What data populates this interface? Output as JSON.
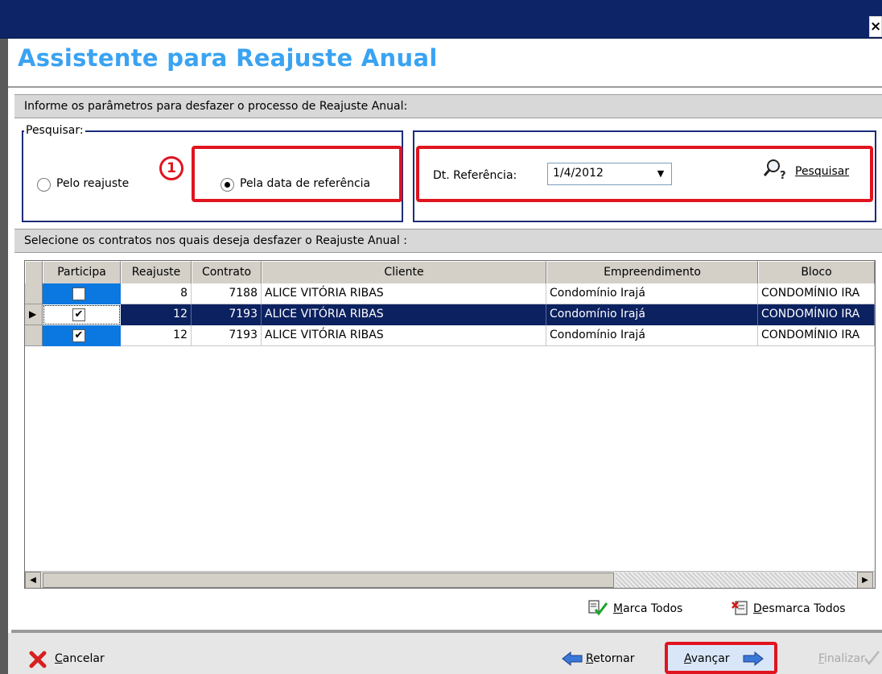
{
  "window": {
    "close_glyph": "×",
    "title": "Assistente para Reajuste Anual"
  },
  "params": {
    "header": "Informe os parâmetros para desfazer o processo de Reajuste Anual:",
    "group_label": "Pesquisar:",
    "annotation_number": "1",
    "option_reajuste": "Pelo reajuste",
    "option_data": "Pela data de referência",
    "selected_option": "data",
    "date_label": "Dt. Referência:",
    "date_value": "1/4/2012",
    "search_label": "Pesquisar"
  },
  "contracts": {
    "header": "Selecione os contratos nos quais deseja desfazer o Reajuste Anual :",
    "columns": [
      "Participa",
      "Reajuste",
      "Contrato",
      "Cliente",
      "Empreendimento",
      "Bloco"
    ],
    "rows": [
      {
        "participa": false,
        "reajuste": "8",
        "contrato": "7188",
        "cliente": "ALICE VITÓRIA RIBAS",
        "empreendimento": "Condomínio Irajá",
        "bloco": "CONDOMÍNIO IRA"
      },
      {
        "participa": true,
        "reajuste": "12",
        "contrato": "7193",
        "cliente": "ALICE VITÓRIA RIBAS",
        "empreendimento": "Condomínio Irajá",
        "bloco": "CONDOMÍNIO IRA"
      },
      {
        "participa": true,
        "reajuste": "12",
        "contrato": "7193",
        "cliente": "ALICE VITÓRIA RIBAS",
        "empreendimento": "Condomínio Irajá",
        "bloco": "CONDOMÍNIO IRA"
      }
    ],
    "selected_row": 1
  },
  "actions": {
    "mark_all": "Marca Todos",
    "unmark_all": "Desmarca Todos"
  },
  "footer": {
    "cancel": "Cancelar",
    "back": "Retornar",
    "next": "Avançar",
    "finish": "Finalizar"
  },
  "colors": {
    "title_bar": "#0d2466",
    "heading": "#3aa3f2",
    "highlight_red": "#e0141f",
    "row_selected": "#0c2160"
  }
}
